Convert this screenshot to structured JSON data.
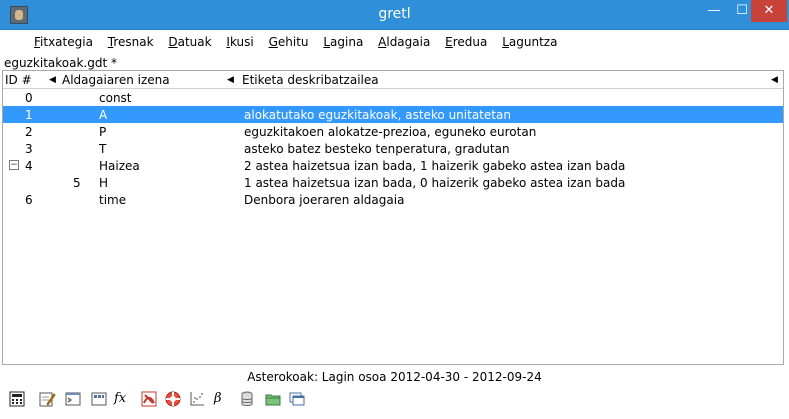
{
  "window": {
    "title": "gretl"
  },
  "controls": {
    "minimize": "—",
    "maximize": "☐",
    "close": "✕"
  },
  "menu": [
    "Fitxategia",
    "Tresnak",
    "Datuak",
    "Ikusi",
    "Gehitu",
    "Lagina",
    "Aldagaia",
    "Eredua",
    "Laguntza"
  ],
  "file_label": "eguzkitakoak.gdt *",
  "list": {
    "headers": {
      "id": "ID #",
      "name": "Aldagaiaren izena",
      "label": "Etiketa deskribatzailea"
    },
    "rows": [
      {
        "id": "0",
        "name": "const",
        "label": ""
      },
      {
        "id": "1",
        "name": "A",
        "label": "alokatutako eguzkitakoak, asteko unitatetan",
        "selected": true
      },
      {
        "id": "2",
        "name": "P",
        "label": "eguzkitakoen alokatze-prezioa, eguneko eurotan"
      },
      {
        "id": "3",
        "name": "T",
        "label": "asteko batez besteko tenperatura, gradutan"
      },
      {
        "id": "4",
        "name": "Haizea",
        "label": "2 astea haizetsua izan bada, 1 haizerik gabeko astea izan bada",
        "expander": "−"
      },
      {
        "id": "5",
        "name": "H",
        "label": "1 astea haizetsua izan bada, 0 haizerik gabeko astea izan bada",
        "child": true
      },
      {
        "id": "6",
        "name": "time",
        "label": "Denbora joeraren aldagaia"
      }
    ]
  },
  "status": "Asterokoak: Lagin osoa 2012-04-30 - 2012-09-24",
  "toolbar_icons": [
    "calculator-icon",
    "script-edit-icon",
    "terminal-icon",
    "session-icon",
    "function-icon",
    "pdf-icon",
    "help-icon",
    "scatter-plot-icon",
    "beta-icon",
    "database-icon",
    "folder-icon",
    "windows-icon"
  ]
}
